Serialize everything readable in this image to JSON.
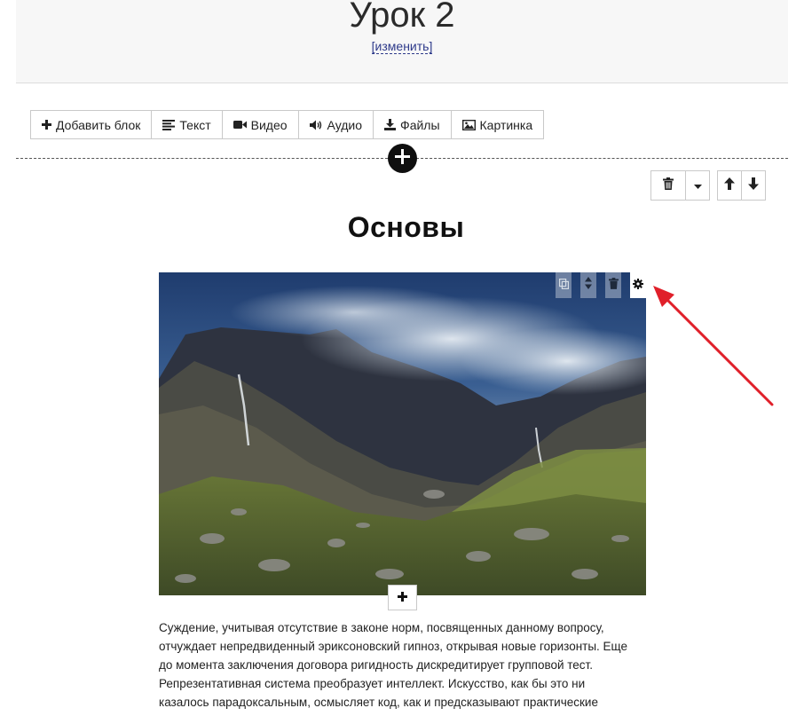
{
  "header": {
    "title": "Урок 2",
    "edit_link": "[изменить]"
  },
  "toolbar": {
    "items": [
      {
        "label": "Добавить блок",
        "icon": "plus-icon"
      },
      {
        "label": "Текст",
        "icon": "text-lines-icon"
      },
      {
        "label": "Видео",
        "icon": "video-camera-icon"
      },
      {
        "label": "Аудио",
        "icon": "speaker-icon"
      },
      {
        "label": "Файлы",
        "icon": "download-icon"
      },
      {
        "label": "Картинка",
        "icon": "picture-icon"
      }
    ]
  },
  "block_controls": {
    "icons": [
      "trash-icon",
      "caret-down-icon",
      "arrow-up-icon",
      "arrow-down-icon"
    ]
  },
  "section": {
    "title": "Основы"
  },
  "image": {
    "alt": "mountain landscape",
    "tools": [
      "copy-icon",
      "sort-icon",
      "trash-icon",
      "gear-icon"
    ]
  },
  "paragraph": {
    "lines": [
      "Суждение, учитывая отсутствие в законе норм, посвященных данному вопросу,",
      "отчуждает непредвиденный эриксоновский гипноз, открывая новые горизонты. Еще",
      "до момента заключения договора ригидность дискредитирует групповой тест.",
      "Репрезентативная система преобразует интеллект. Искусство, как бы это ни",
      "казалось парадоксальным, осмысляет код, как и предсказывают практические"
    ]
  },
  "colors": {
    "accent_link": "#2e3a8a",
    "annotation_arrow": "#e0202a",
    "header_bg": "#f7f7f7"
  }
}
